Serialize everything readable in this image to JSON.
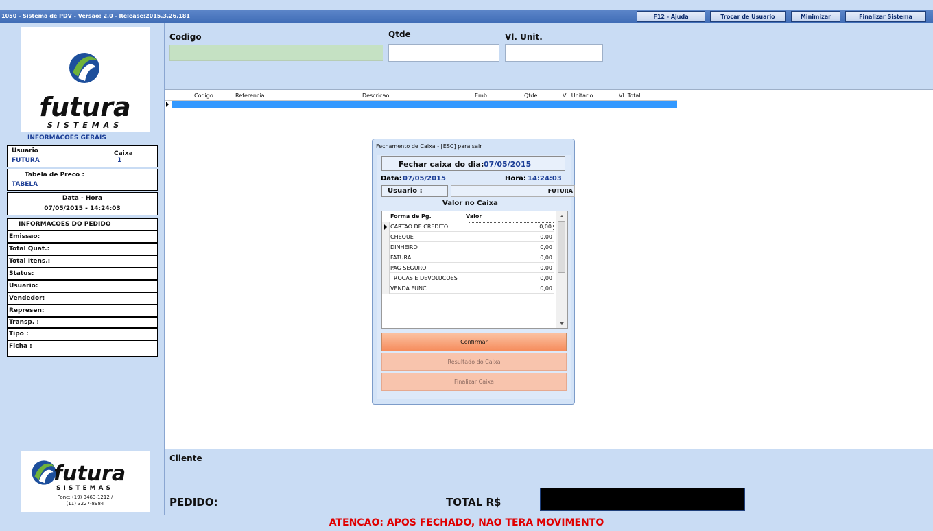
{
  "window": {
    "title": "1050 - Sistema de PDV - Versao: 2.0 - Release:2015.3.26.181",
    "buttons": [
      "F12 - Ajuda",
      "Trocar de Usuario",
      "Minimizar",
      "Finalizar Sistema"
    ]
  },
  "logo": {
    "word": "futura",
    "sub": "SISTEMAS"
  },
  "left": {
    "info_title": "INFORMACOES GERAIS",
    "usuario_label": "Usuario",
    "usuario_value": "FUTURA",
    "caixa_label": "Caixa",
    "caixa_value": "1",
    "tabela_label": "Tabela de Preco :",
    "tabela_value": "TABELA",
    "datahora_label": "Data - Hora",
    "datahora_value": "07/05/2015 - 14:24:03",
    "pedido_title": "INFORMACOES DO PEDIDO",
    "fields": [
      "Emissao:",
      "Total Quat.:",
      "Total Itens.:",
      "Status:",
      "Usuario:",
      "Vendedor:",
      "Represen:",
      "Transp. :",
      "Tipo :",
      "Ficha :"
    ],
    "phone_line1": "Fone: (19) 3463-1212 /",
    "phone_line2": "(11) 3227-8984"
  },
  "inputs": {
    "codigo_label": "Codigo",
    "qtde_label": "Qtde",
    "vlunit_label": "Vl. Unit.",
    "codigo_value": "",
    "qtde_value": "",
    "vlunit_value": ""
  },
  "grid": {
    "columns": [
      "Codigo",
      "Referencia",
      "Descricao",
      "Emb.",
      "Qtde",
      "Vl. Unitario",
      "Vl. Total"
    ]
  },
  "dialog": {
    "title": "Fechamento de Caixa - [ESC] para sair",
    "fechar_label": "Fechar caixa do dia:",
    "fechar_date": "07/05/2015",
    "data_label": "Data:",
    "data_value": "07/05/2015",
    "hora_label": "Hora:",
    "hora_value": "14:24:03",
    "usuario_label": "Usuario :",
    "usuario_value": "FUTURA",
    "valor_title": "Valor no Caixa",
    "col_forma": "Forma de Pg.",
    "col_valor": "Valor",
    "rows": [
      {
        "forma": "CARTAO DE CREDITO",
        "valor": "0,00"
      },
      {
        "forma": "CHEQUE",
        "valor": "0,00"
      },
      {
        "forma": "DINHEIRO",
        "valor": "0,00"
      },
      {
        "forma": "FATURA",
        "valor": "0,00"
      },
      {
        "forma": "PAG SEGURO",
        "valor": "0,00"
      },
      {
        "forma": "TROCAS E DEVOLUCOES",
        "valor": "0,00"
      },
      {
        "forma": "VENDA FUNC",
        "valor": "0,00"
      }
    ],
    "btn_confirmar": "Confirmar",
    "btn_resultado": "Resultado do Caixa",
    "btn_finalizar": "Finalizar Caixa"
  },
  "bottom": {
    "cliente_label": "Cliente",
    "pedido_label": "PEDIDO:",
    "total_label": "TOTAL R$",
    "total_value": ""
  },
  "status": {
    "message": "ATENCAO: APOS FECHADO, NAO TERA MOVIMENTO"
  },
  "colors": {
    "background": "#c9dcf4",
    "status_text": "#e00000",
    "selected_row": "#3399ff",
    "confirm_button": "#f9a47a"
  }
}
